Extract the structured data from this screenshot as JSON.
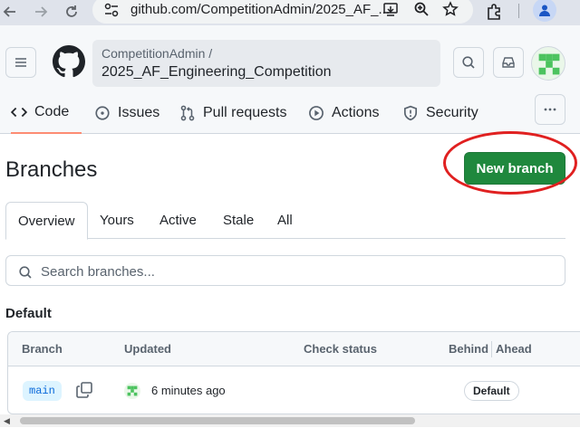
{
  "browser": {
    "url": "github.com/CompetitionAdmin/2025_AF_..."
  },
  "repo": {
    "owner": "CompetitionAdmin /",
    "name": "2025_AF_Engineering_Competition"
  },
  "tabs": [
    {
      "label": "Code",
      "icon": "code-icon"
    },
    {
      "label": "Issues",
      "icon": "issue-icon"
    },
    {
      "label": "Pull requests",
      "icon": "pull-request-icon"
    },
    {
      "label": "Actions",
      "icon": "play-icon"
    },
    {
      "label": "Security",
      "icon": "shield-icon"
    }
  ],
  "page": {
    "title": "Branches",
    "new_branch_label": "New branch"
  },
  "subtabs": [
    "Overview",
    "Yours",
    "Active",
    "Stale",
    "All"
  ],
  "search": {
    "placeholder": "Search branches..."
  },
  "section": {
    "title": "Default"
  },
  "table": {
    "headers": {
      "branch": "Branch",
      "updated": "Updated",
      "check_status": "Check status",
      "behind": "Behind",
      "ahead": "Ahead"
    },
    "rows": [
      {
        "branch": "main",
        "updated": "6 minutes ago",
        "badge": "Default"
      }
    ]
  },
  "colors": {
    "primary_button": "#1f883d",
    "highlight_ring": "#e02020",
    "selected_tab_underline": "#fd8c73"
  }
}
